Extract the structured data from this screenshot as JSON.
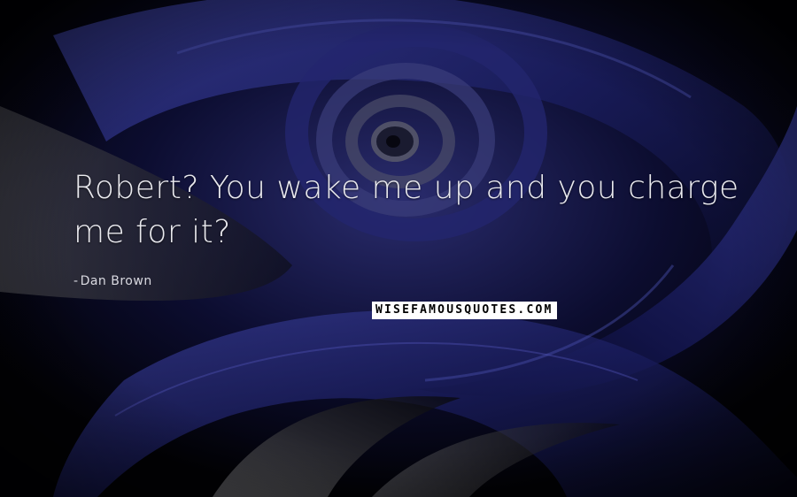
{
  "quote": {
    "text": "Robert? You wake me up and you charge me for it?",
    "author": "Dan Brown",
    "author_prefix": "-"
  },
  "watermark": {
    "text": "WISEFAMOUSQUOTES.COM"
  },
  "colors": {
    "background": "#020206",
    "swirl_blue": "#1a1d5e",
    "swirl_highlight": "#3a3f9a",
    "swirl_gray": "#4a4a50",
    "text": "#e9e9ee"
  }
}
